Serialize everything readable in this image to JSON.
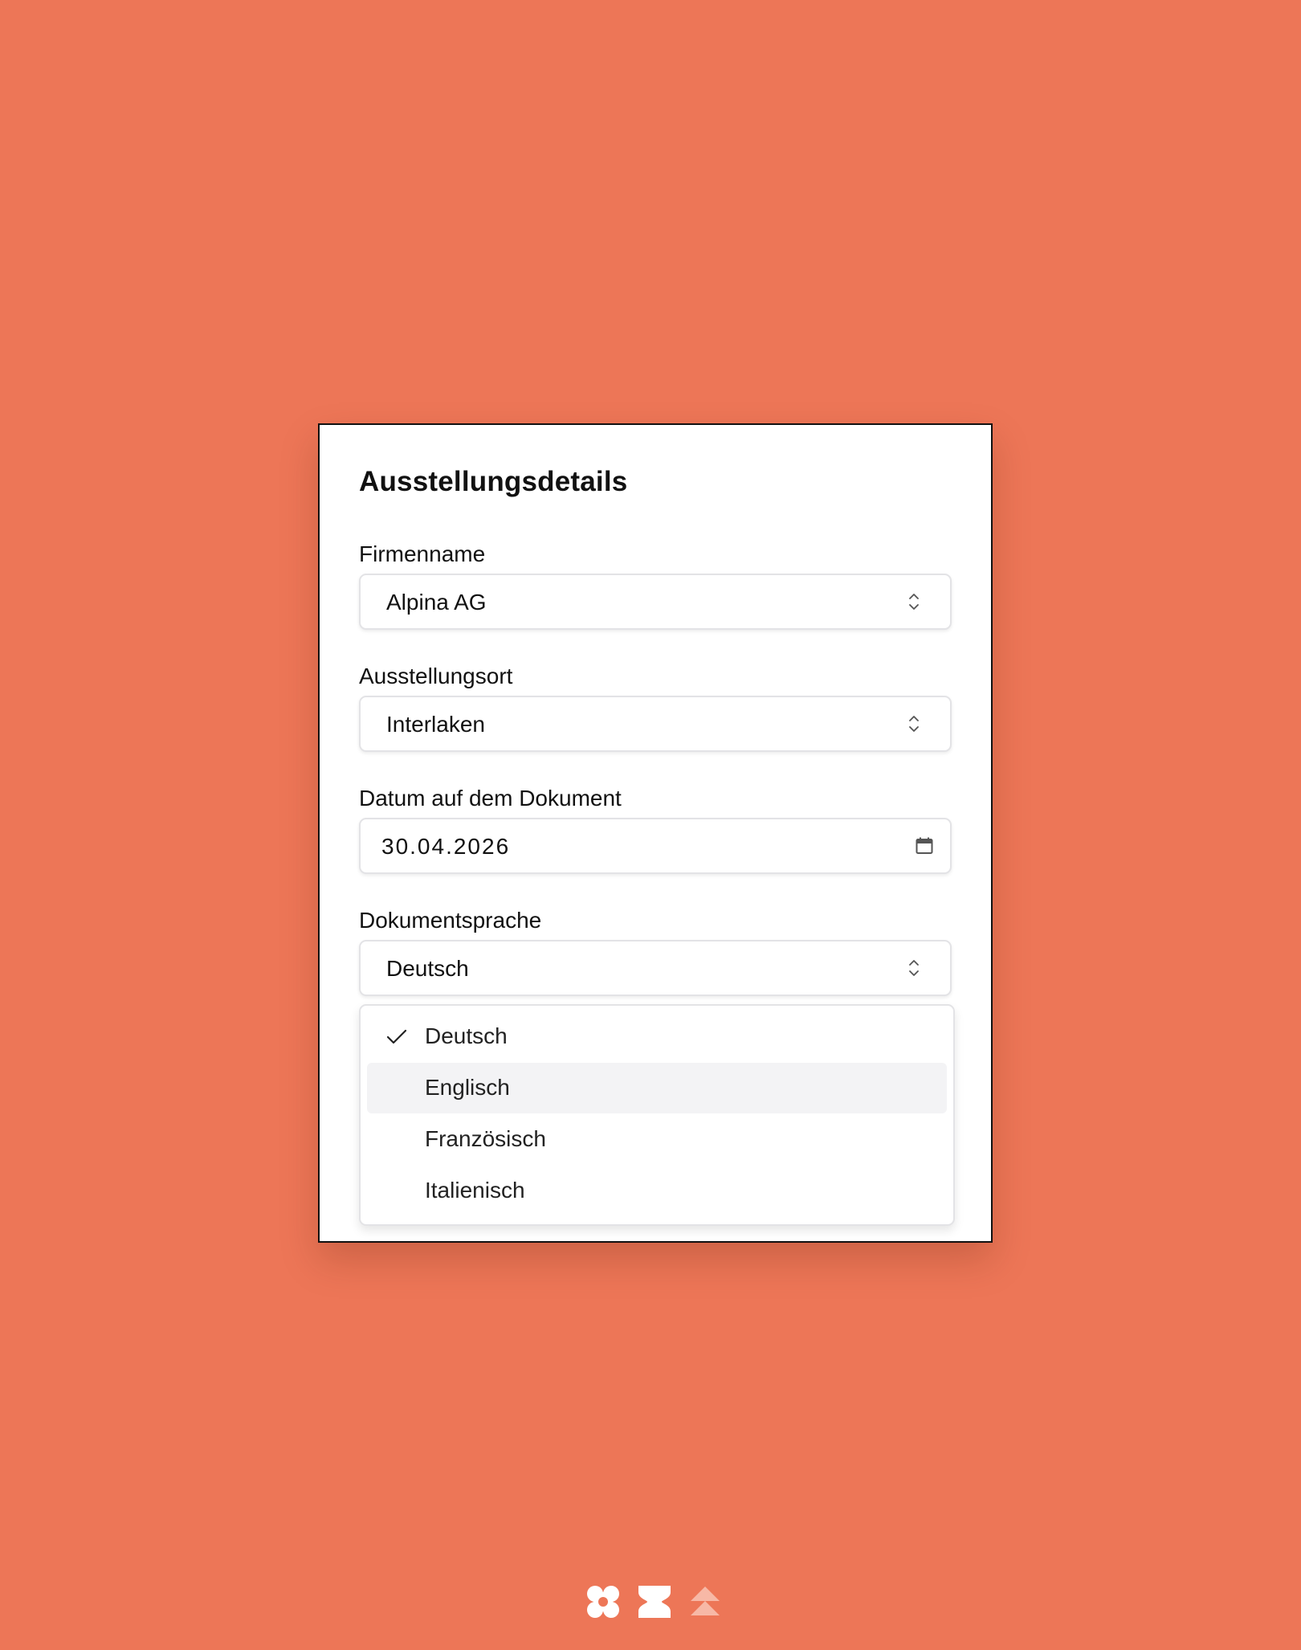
{
  "card": {
    "title": "Ausstellungsdetails"
  },
  "fields": {
    "company": {
      "label": "Firmenname",
      "value": "Alpina AG"
    },
    "location": {
      "label": "Ausstellungsort",
      "value": "Interlaken"
    },
    "date": {
      "label": "Datum auf dem Dokument",
      "value": "30.04.2026"
    },
    "language": {
      "label": "Dokumentsprache",
      "value": "Deutsch",
      "options": [
        {
          "label": "Deutsch",
          "selected": true
        },
        {
          "label": "Englisch",
          "hovered": true
        },
        {
          "label": "Französisch"
        },
        {
          "label": "Italienisch"
        }
      ]
    }
  },
  "icons": {
    "select": "chevron-up-down-icon",
    "date": "calendar-icon",
    "selected_option": "checkmark-icon"
  },
  "colors": {
    "background": "#ED7657",
    "card": "#FFFFFF",
    "option_hover": "#F3F3F5",
    "logo_fill": "#FFFFFF",
    "logo_faded": "#F7B8A6"
  }
}
